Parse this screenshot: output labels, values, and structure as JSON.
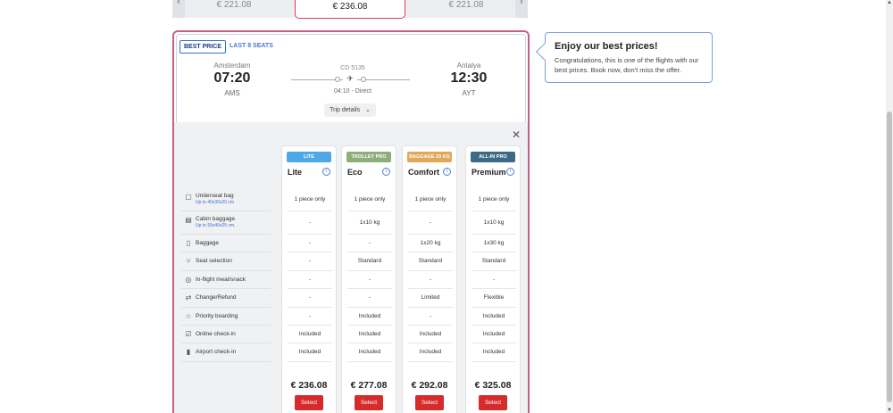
{
  "carousel": {
    "prev_price": "€ 221.08",
    "selected_price": "€ 236.08",
    "next_price": "€ 221.08",
    "left_arrow": "‹",
    "right_arrow": "›"
  },
  "flight": {
    "badge_best": "BEST PRICE",
    "badge_seats": "LAST 8 SEATS",
    "from_city": "Amsterdam",
    "from_time": "07:20",
    "from_code": "AMS",
    "flight_no": "CD 5135",
    "duration": "04:10 - Direct",
    "to_city": "Antalya",
    "to_time": "12:30",
    "to_code": "AYT",
    "trip_details": "Trip details"
  },
  "features": [
    {
      "label": "Underseat bag",
      "sub": "Up to 40x30x20 cm",
      "icon": "bag-icon"
    },
    {
      "label": "Cabin baggage",
      "sub": "Up to 55x40x25 cm.",
      "icon": "suitcase-icon"
    },
    {
      "label": "Baggage",
      "sub": "",
      "icon": "luggage-icon"
    },
    {
      "label": "Seat selection",
      "sub": "",
      "icon": "seat-icon"
    },
    {
      "label": "In-flight meal/snack",
      "sub": "",
      "icon": "meal-icon"
    },
    {
      "label": "Change/Refund",
      "sub": "",
      "icon": "refund-icon"
    },
    {
      "label": "Priority boarding",
      "sub": "",
      "icon": "star-icon"
    },
    {
      "label": "Online check-in",
      "sub": "",
      "icon": "online-checkin-icon"
    },
    {
      "label": "Airport check-in",
      "sub": "",
      "icon": "airport-checkin-icon"
    }
  ],
  "fares": [
    {
      "badge": "LITE",
      "badge_color": "#4ea8e8",
      "name": "Lite",
      "price": "€ 236.08",
      "select": "Select",
      "cells": [
        "1 piece only",
        "-",
        "-",
        "-",
        "-",
        "-",
        "-",
        "Included",
        "Included"
      ]
    },
    {
      "badge": "TROLLEY PRO",
      "badge_color": "#8cae7a",
      "name": "Eco",
      "price": "€ 277.08",
      "select": "Select",
      "cells": [
        "1 piece only",
        "1x10 kg",
        "-",
        "Standard",
        "-",
        "-",
        "Included",
        "Included",
        "Included"
      ]
    },
    {
      "badge": "BAGGAGE 20 KG",
      "badge_color": "#e0a85a",
      "name": "Comfort",
      "price": "€ 292.08",
      "select": "Select",
      "cells": [
        "1 piece only",
        "-",
        "1x20 kg",
        "Standard",
        "-",
        "Limited",
        "-",
        "Included",
        "Included"
      ]
    },
    {
      "badge": "ALL-IN PRO",
      "badge_color": "#3b6a86",
      "name": "Premium",
      "price": "€ 325.08",
      "select": "Select",
      "cells": [
        "1 piece only",
        "1x10 kg",
        "1x30 kg",
        "Standard",
        "-",
        "Flexible",
        "Included",
        "Included",
        "Included"
      ]
    }
  ],
  "popup": {
    "title": "Enjoy our best prices!",
    "body": "Congratulations, this is one of the flights with our best prices. Book now, don't miss the offer."
  },
  "icons": {
    "close": "✕",
    "info": "i",
    "chevron": "⌄",
    "plane": "✈",
    "scroll_up": "▲",
    "scroll_down": "▼"
  }
}
